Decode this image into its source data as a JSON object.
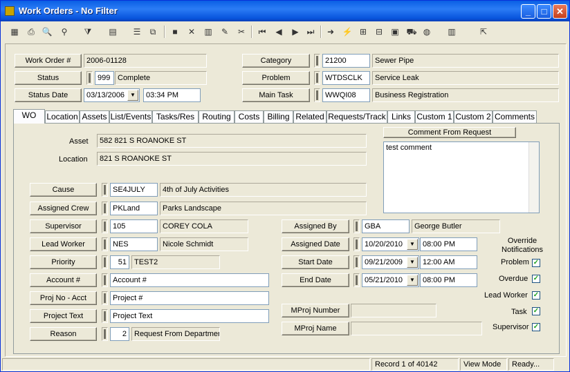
{
  "window": {
    "title": "Work Orders - No Filter",
    "minimize": "_",
    "maximize": "□",
    "close": "✕"
  },
  "toolbar": [
    {
      "icon": "new-icon",
      "glyph": "▦"
    },
    {
      "icon": "print-icon",
      "glyph": "⎙"
    },
    {
      "icon": "preview-icon",
      "glyph": "🔍"
    },
    {
      "icon": "binoculars-icon",
      "glyph": "⚲"
    },
    {
      "icon": "filter-icon",
      "glyph": "⧩"
    },
    {
      "icon": "report-icon",
      "glyph": "▤"
    },
    {
      "icon": "properties-icon",
      "glyph": "☰"
    },
    {
      "icon": "copy-icon",
      "glyph": "⧉"
    },
    {
      "icon": "save-icon",
      "glyph": "■"
    },
    {
      "icon": "delete-icon",
      "glyph": "✕"
    },
    {
      "icon": "books-icon",
      "glyph": "▥"
    },
    {
      "icon": "pencil-icon",
      "glyph": "✎"
    },
    {
      "icon": "cut-icon",
      "glyph": "✂"
    },
    {
      "icon": "first-record-icon",
      "glyph": "⏮"
    },
    {
      "icon": "prev-record-icon",
      "glyph": "◀"
    },
    {
      "icon": "next-record-icon",
      "glyph": "▶"
    },
    {
      "icon": "last-record-icon",
      "glyph": "⏭"
    },
    {
      "icon": "goto-icon",
      "glyph": "➜"
    },
    {
      "icon": "lightning-icon",
      "glyph": "⚡"
    },
    {
      "icon": "hierarchy-icon",
      "glyph": "⊞"
    },
    {
      "icon": "tree-icon",
      "glyph": "⊟"
    },
    {
      "icon": "map-icon",
      "glyph": "▣"
    },
    {
      "icon": "truck-icon",
      "glyph": "⛟"
    },
    {
      "icon": "globe-icon",
      "glyph": "◍"
    },
    {
      "icon": "library-icon",
      "glyph": "▥"
    },
    {
      "icon": "exit-icon",
      "glyph": "⇱"
    }
  ],
  "header": {
    "work_order_label": "Work Order #",
    "work_order_value": "2006-01128",
    "status_label": "Status",
    "status_code": "999",
    "status_desc": "Complete",
    "status_date_label": "Status Date",
    "status_date": "03/13/2006",
    "status_time": "03:34 PM",
    "category_label": "Category",
    "category_code": "21200",
    "category_desc": "Sewer Pipe",
    "problem_label": "Problem",
    "problem_code": "WTDSCLK",
    "problem_desc": "Service Leak",
    "main_task_label": "Main Task",
    "main_task_code": "WWQI08",
    "main_task_desc": "Business Registration"
  },
  "tabs": [
    "WO",
    "Location",
    "Assets",
    "List/Events",
    "Tasks/Res",
    "Routing",
    "Costs",
    "Billing",
    "Related",
    "Requests/Track",
    "Links",
    "Custom 1",
    "Custom 2",
    "Comments"
  ],
  "wo": {
    "asset_label": "Asset",
    "asset_value": "582 821 S ROANOKE ST",
    "location_label": "Location",
    "location_value": "821 S ROANOKE ST",
    "comment_label": "Comment From Request",
    "comment_value": "test comment",
    "cause_label": "Cause",
    "cause_code": "SE4JULY",
    "cause_desc": "4th of July Activities",
    "crew_label": "Assigned Crew",
    "crew_code": "PKLand",
    "crew_desc": "Parks Landscape",
    "supervisor_label": "Supervisor",
    "supervisor_code": "105",
    "supervisor_desc": "COREY COLA",
    "lead_label": "Lead Worker",
    "lead_code": "NES",
    "lead_desc": "Nicole Schmidt",
    "priority_label": "Priority",
    "priority_code": "51",
    "priority_desc": "TEST2",
    "account_label": "Account #",
    "account_value": "Account #",
    "proj_acct_label": "Proj No - Acct",
    "proj_acct_value": "Project #",
    "proj_text_label": "Project Text",
    "proj_text_value": "Project Text",
    "reason_label": "Reason",
    "reason_code": "2",
    "reason_desc": "Request From Departmen",
    "assigned_by_label": "Assigned By",
    "assigned_by_code": "GBA",
    "assigned_by_desc": "George Butler",
    "assigned_date_label": "Assigned Date",
    "assigned_date": "10/20/2010",
    "assigned_time": "08:00 PM",
    "start_date_label": "Start Date",
    "start_date": "09/21/2009",
    "start_time": "12:00 AM",
    "end_date_label": "End Date",
    "end_date": "05/21/2010",
    "end_time": "08:00 PM",
    "mproj_number_label": "MProj Number",
    "mproj_name_label": "MProj Name",
    "override_title": "Override Notifications",
    "notif_problem": "Problem",
    "notif_overdue": "Overdue",
    "notif_lead": "Lead Worker",
    "notif_task": "Task",
    "notif_supervisor": "Supervisor",
    "check": "✓"
  },
  "status": {
    "record": "Record 1 of 40142",
    "mode": "View Mode",
    "ready": "Ready..."
  }
}
